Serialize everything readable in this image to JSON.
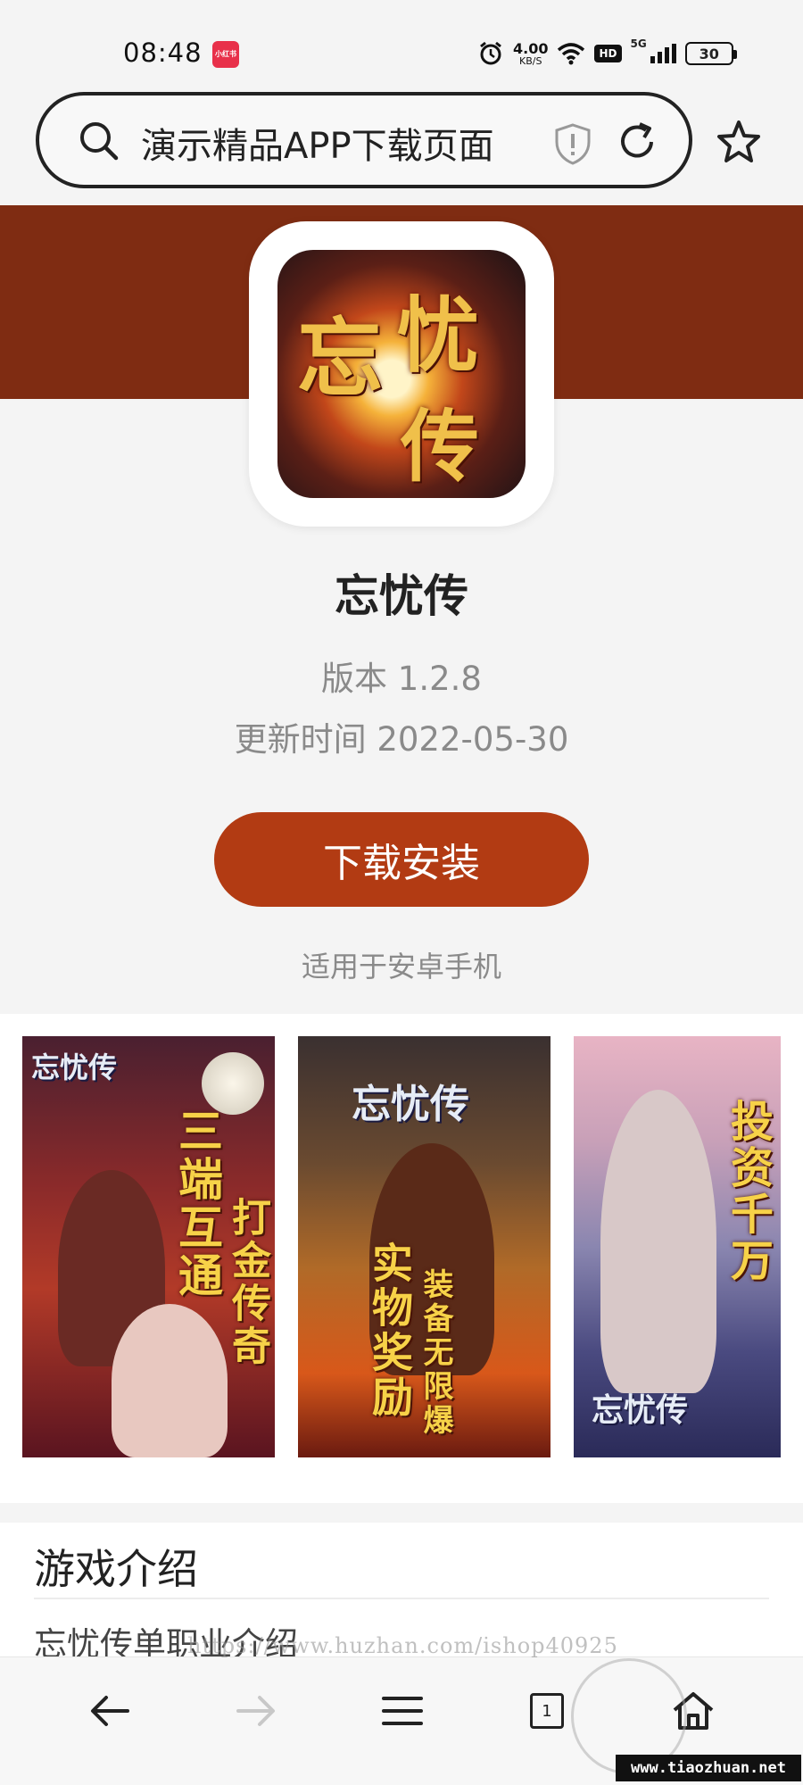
{
  "status_bar": {
    "time": "08:48",
    "app_badge": "小红书",
    "net_speed": "4.00",
    "net_unit": "KB/S",
    "hd": "HD",
    "network": "5G",
    "battery": "30"
  },
  "browser": {
    "url_text": "演示精品APP下载页面"
  },
  "app": {
    "icon_text": [
      "忘",
      "忧",
      "传"
    ],
    "name": "忘忧传",
    "version": "版本 1.2.8",
    "updated": "更新时间 2022-05-30",
    "download_label": "下载安装",
    "compat": "适用于安卓手机"
  },
  "screenshots": [
    {
      "logo": "忘忧传",
      "text_a": "三端互通",
      "text_b": "打金传奇"
    },
    {
      "logo": "忘忧传",
      "text_a": "实物奖励",
      "text_b": "装备无限爆"
    },
    {
      "logo": "忘忧传",
      "text_a": "投资千万"
    }
  ],
  "intro": {
    "title": "游戏介绍",
    "subtitle": "忘忧传单职业介绍"
  },
  "watermark": {
    "url": "https://www.huzhan.com/ishop40925",
    "badge": "www.tiaozhuan.net"
  },
  "bottom_nav": {
    "tab_count": "1"
  },
  "colors": {
    "brand": "#b23b13",
    "band": "#7f2c12"
  }
}
